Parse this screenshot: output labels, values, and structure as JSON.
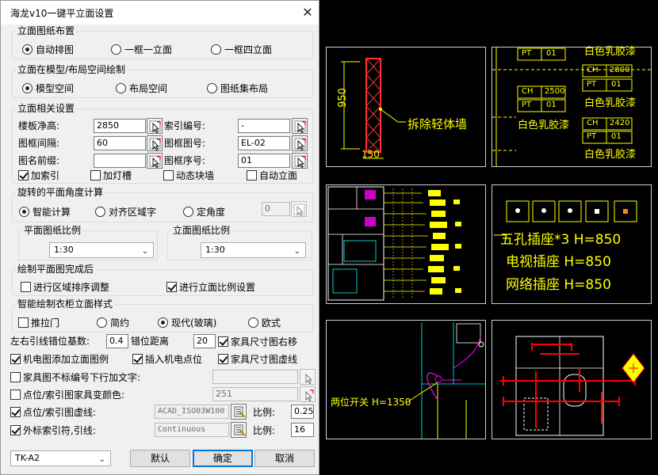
{
  "dialog": {
    "title": "海龙v10一键平立面设置",
    "close_icon": "close-icon"
  },
  "layout_group": {
    "label": "立面图纸布置",
    "options": [
      "自动排图",
      "一框一立面",
      "一框四立面"
    ],
    "selected": "自动排图"
  },
  "space_group": {
    "label": "立面在模型/布局空间绘制",
    "options": [
      "模型空间",
      "布局空间",
      "图纸集布局"
    ],
    "selected": "模型空间"
  },
  "related": {
    "label": "立面相关设置",
    "floor_height_label": "楼板净高:",
    "floor_height": "2850",
    "index_no_label": "索引编号:",
    "index_no": "-",
    "spacing_label": "图框间隔:",
    "spacing": "60",
    "frame_no_label": "图框图号:",
    "frame_no": "EL-02",
    "prefix_label": "图名前缀:",
    "prefix": "",
    "frame_seq_label": "图框序号:",
    "frame_seq": "01",
    "checks": [
      {
        "label": "加索引",
        "checked": true
      },
      {
        "label": "加灯槽",
        "checked": false
      },
      {
        "label": "动态块墙",
        "checked": false
      },
      {
        "label": "自动立面",
        "checked": false
      }
    ]
  },
  "rotation": {
    "label": "旋转的平面角度计算",
    "options": [
      "智能计算",
      "对齐区域字",
      "定角度"
    ],
    "selected": "智能计算",
    "angle": "0"
  },
  "plan_scale": {
    "label": "平面图纸比例",
    "value": "1:30"
  },
  "elev_scale": {
    "label": "立面图纸比例",
    "value": "1:30"
  },
  "after_plan": {
    "label": "绘制平面图完成后",
    "checks": [
      {
        "label": "进行区域排序调整",
        "checked": false
      },
      {
        "label": "进行立面比例设置",
        "checked": true
      }
    ]
  },
  "wardrobe": {
    "label": "智能绘制衣柜立面样式",
    "options": [
      "推拉门",
      "简约",
      "现代(玻璃)",
      "欧式"
    ],
    "selected": "现代(玻璃)"
  },
  "offset": {
    "base_label": "左右引线错位基数:",
    "base": "0.4",
    "dist_label": "错位距离",
    "dist": "20"
  },
  "misc": {
    "furn_right": {
      "label": "家具尺寸图右移",
      "checked": true
    },
    "mep_elev": {
      "label": "机电图添加立面图例",
      "checked": true
    },
    "insert_points": {
      "label": "插入机电点位",
      "checked": true
    },
    "furn_dashed": {
      "label": "家具尺寸图虚线",
      "checked": true
    },
    "furn_text": {
      "label": "家具图不标编号下行加文字:",
      "checked": false,
      "value": ""
    },
    "color": {
      "label": "点位/索引图家具变颜色:",
      "checked": false,
      "value": "251"
    },
    "dashed": {
      "label": "点位/索引图虚线:",
      "checked": true,
      "value": "ACAD_ISO03W100",
      "ratio_label": "比例:",
      "ratio": "0.25"
    },
    "leader": {
      "label": "外标索引符,引线:",
      "checked": true,
      "value": "Continuous",
      "ratio_label": "比例:",
      "ratio": "16"
    }
  },
  "footer": {
    "template": "TK-A2",
    "default_btn": "默认",
    "ok_btn": "确定",
    "cancel_btn": "取消"
  },
  "cad": {
    "c1_texts": [
      "950",
      "150",
      "拆除轻体墙"
    ],
    "c2_texts": [
      "PT",
      "01",
      "白色乳胶漆",
      "CH",
      "2800",
      "PT",
      "01",
      "白色乳胶漆",
      "CH",
      "2500",
      "PT",
      "01",
      "白色乳胶漆",
      "CH",
      "2420",
      "PT",
      "01",
      "白色乳胶漆"
    ],
    "c4_texts": [
      "五孔插座*3 H=850",
      "电视插座 H=850",
      "网络插座 H=850"
    ],
    "c5_texts": [
      "两位开关 H=1350"
    ],
    "colors": {
      "line": "#ffff00",
      "accent": "#ff0000",
      "magenta": "#ff00ff",
      "cyan": "#00ffff",
      "bg": "#000000"
    }
  }
}
